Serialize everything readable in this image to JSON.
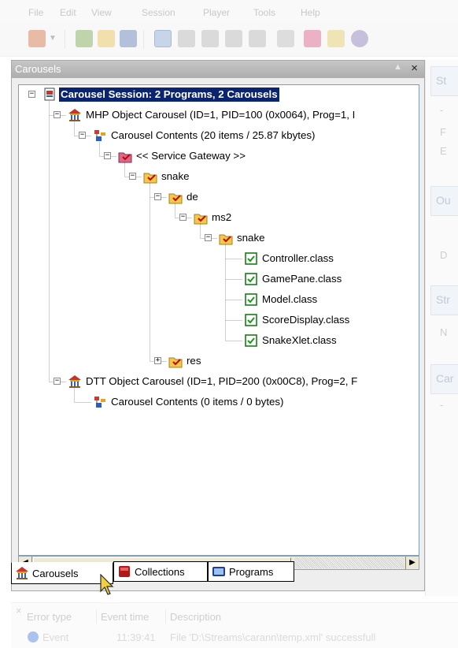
{
  "menu": [
    "File",
    "Edit",
    "View",
    "Session",
    "Player",
    "Tools",
    "Help"
  ],
  "panel": {
    "title": "Carousels",
    "min_label": "▲",
    "close_label": "×"
  },
  "tree": [
    {
      "label": "Carousel Session: 2 Programs, 2 Carousels",
      "icon": "session-icon",
      "selected": true
    },
    {
      "label": "MHP Object Carousel (ID=1, PID=100 (0x0064), Prog=1, I",
      "icon": "carousel-icon"
    },
    {
      "label": "Carousel Contents (20 items / 25.87 kbytes)",
      "icon": "contents-icon"
    },
    {
      "label": "<< Service Gateway >>",
      "icon": "service-gateway-folder-icon"
    },
    {
      "label": "snake",
      "icon": "folder-icon"
    },
    {
      "label": "de",
      "icon": "folder-icon"
    },
    {
      "label": "ms2",
      "icon": "folder-icon"
    },
    {
      "label": "snake",
      "icon": "folder-icon"
    },
    {
      "label": "Controller.class",
      "icon": "class-file-icon"
    },
    {
      "label": "GamePane.class",
      "icon": "class-file-icon"
    },
    {
      "label": "Model.class",
      "icon": "class-file-icon"
    },
    {
      "label": "ScoreDisplay.class",
      "icon": "class-file-icon"
    },
    {
      "label": "SnakeXlet.class",
      "icon": "class-file-icon"
    },
    {
      "label": "res",
      "icon": "folder-icon"
    },
    {
      "label": "DTT Object Carousel (ID=1, PID=200 (0x00C8), Prog=2, F",
      "icon": "carousel-icon"
    },
    {
      "label": "Carousel Contents (0 items / 0 bytes)",
      "icon": "contents-icon"
    }
  ],
  "tabs": [
    {
      "label": "Carousels",
      "icon": "carousel-icon"
    },
    {
      "label": "Collections",
      "icon": "collections-icon"
    },
    {
      "label": "Programs",
      "icon": "programs-icon"
    }
  ],
  "right_panel": {
    "tabs": [
      "St",
      "Ou",
      "Str",
      "Car"
    ],
    "texts": [
      "-",
      "F",
      "E",
      "D",
      "N",
      "-"
    ]
  },
  "error_list": {
    "close_label": "×",
    "columns": [
      "Error type",
      "Event time",
      "Description"
    ],
    "row": {
      "type": "Event",
      "time": "11:39:41",
      "description": "File 'D:\\Streams\\carann\\temp.xml' successfull"
    }
  },
  "colors": {
    "selection": "#0b2470",
    "tree_border": "#7f9db9",
    "panel_title": "#b5b5b5"
  }
}
